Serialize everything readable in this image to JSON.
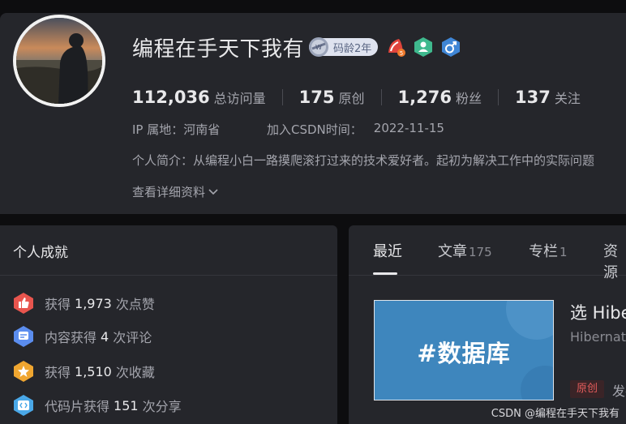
{
  "profile": {
    "name": "编程在手天下我有",
    "code_age": "码龄2年",
    "stats": [
      {
        "num": "112,036",
        "label": "总访问量"
      },
      {
        "num": "175",
        "label": "原创"
      },
      {
        "num": "1,276",
        "label": "粉丝"
      },
      {
        "num": "137",
        "label": "关注"
      }
    ],
    "ip_label": "IP 属地：河南省",
    "join_label": "加入CSDN时间：",
    "join_date": "2022-11-15",
    "bio": "个人简介：从编程小白一路摸爬滚打过来的技术爱好者。起初为解决工作中的实际问题",
    "more_label": "查看详细资料"
  },
  "achievements": {
    "title": "个人成就",
    "items": [
      {
        "pre": "获得",
        "num": "1,973",
        "post": "次点赞",
        "icon": "thumb-up-icon",
        "color": "#e8554e"
      },
      {
        "pre": "内容获得",
        "num": "4",
        "post": "次评论",
        "icon": "comment-icon",
        "color": "#5b8def"
      },
      {
        "pre": "获得",
        "num": "1,510",
        "post": "次收藏",
        "icon": "star-icon",
        "color": "#f0a630"
      },
      {
        "pre": "代码片获得",
        "num": "151",
        "post": "次分享",
        "icon": "code-icon",
        "color": "#4aa8e8"
      }
    ]
  },
  "tabs": [
    {
      "label": "最近",
      "count": ""
    },
    {
      "label": "文章",
      "count": "175"
    },
    {
      "label": "专栏",
      "count": "1"
    },
    {
      "label": "资源",
      "count": ""
    }
  ],
  "article": {
    "thumb_text": "#数据库",
    "title": "选 Hibernate",
    "desc": "Hibernate 表的映射",
    "tag": "原创",
    "publish": "发布"
  },
  "watermark": "CSDN @编程在手天下我有"
}
